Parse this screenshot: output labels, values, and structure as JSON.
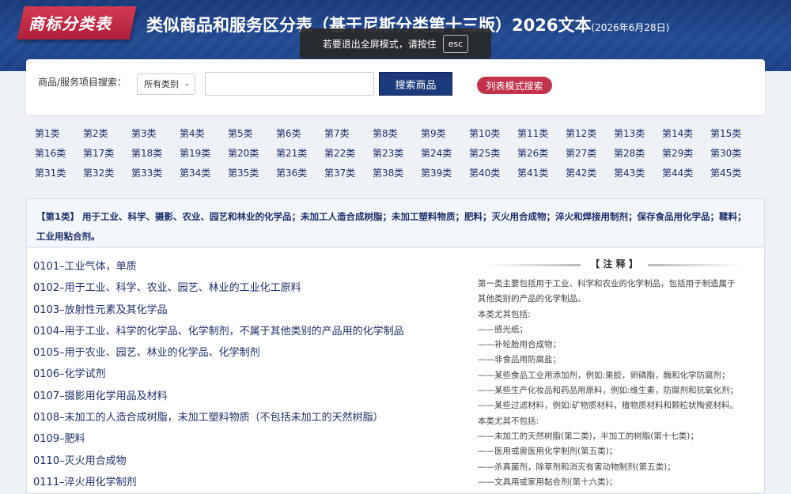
{
  "header": {
    "logo": "商标分类表",
    "title": "类似商品和服务区分表（基于尼斯分类第十三版）2026文本",
    "title_date": "(2026年6月28日)"
  },
  "overlay": {
    "message": "若要退出全屏模式，请按住",
    "key": "esc"
  },
  "search": {
    "label": "商品/服务项目搜索：",
    "category_selected": "所有类别",
    "input_value": "",
    "search_button": "搜索商品",
    "list_mode_button": "列表模式搜索"
  },
  "classes": [
    "第1类",
    "第2类",
    "第3类",
    "第4类",
    "第5类",
    "第6类",
    "第7类",
    "第8类",
    "第9类",
    "第10类",
    "第11类",
    "第12类",
    "第13类",
    "第14类",
    "第15类",
    "第16类",
    "第17类",
    "第18类",
    "第19类",
    "第20类",
    "第21类",
    "第22类",
    "第23类",
    "第24类",
    "第25类",
    "第26类",
    "第27类",
    "第28类",
    "第29类",
    "第30类",
    "第31类",
    "第32类",
    "第33类",
    "第34类",
    "第35类",
    "第36类",
    "第37类",
    "第38类",
    "第39类",
    "第40类",
    "第41类",
    "第42类",
    "第43类",
    "第44类",
    "第45类"
  ],
  "class_description": "【第1类】 用于工业、科学、摄影、农业、园艺和林业的化学品；未加工人造合成树脂；未加工塑料物质；肥料；灭火用合成物；淬火和焊接用制剂；保存食品用化学品；鞣料；工业用粘合剂。",
  "subclasses": [
    "0101–工业气体，单质",
    "0102–用于工业、科学、农业、园艺、林业的工业化工原料",
    "0103–放射性元素及其化学品",
    "0104–用于工业、科学的化学品、化学制剂，不属于其他类别的产品用的化学制品",
    "0105–用于农业、园艺、林业的化学品、化学制剂",
    "0106–化学试剂",
    "0107–摄影用化学用品及材料",
    "0108–未加工的人造合成树脂，未加工塑料物质（不包括未加工的天然树脂）",
    "0109–肥料",
    "0110–灭火用合成物",
    "0111–淬火用化学制剂"
  ],
  "notes": {
    "title": "【 注 释 】",
    "lines": [
      "第一类主要包括用于工业、科学和农业的化学制品，包括用于制造属于",
      "其他类别的产品的化学制品。",
      "本类尤其包括:",
      "——感光纸；",
      "——补轮胎用合成物；",
      "——非食品用防腐盐；",
      "——某些食品工业用添加剂，例如:果胶，卵磷脂，酶和化学防腐剂；",
      "——某些生产化妆品和药品用原料，例如:维生素，防腐剂和抗氧化剂；",
      "——某些过滤材料，例如:矿物质材料，植物质材料和颗粒状陶瓷材料。",
      "本类尤其不包括:",
      "——未加工的天然树脂(第二类)，半加工的树脂(第十七类)；",
      "——医用或兽医用化学制剂(第五类)；",
      "——杀真菌剂，除草剂和消灭有害动物制剂(第五类)；",
      "——文具用或家用黏合剂(第十六类)；"
    ]
  }
}
